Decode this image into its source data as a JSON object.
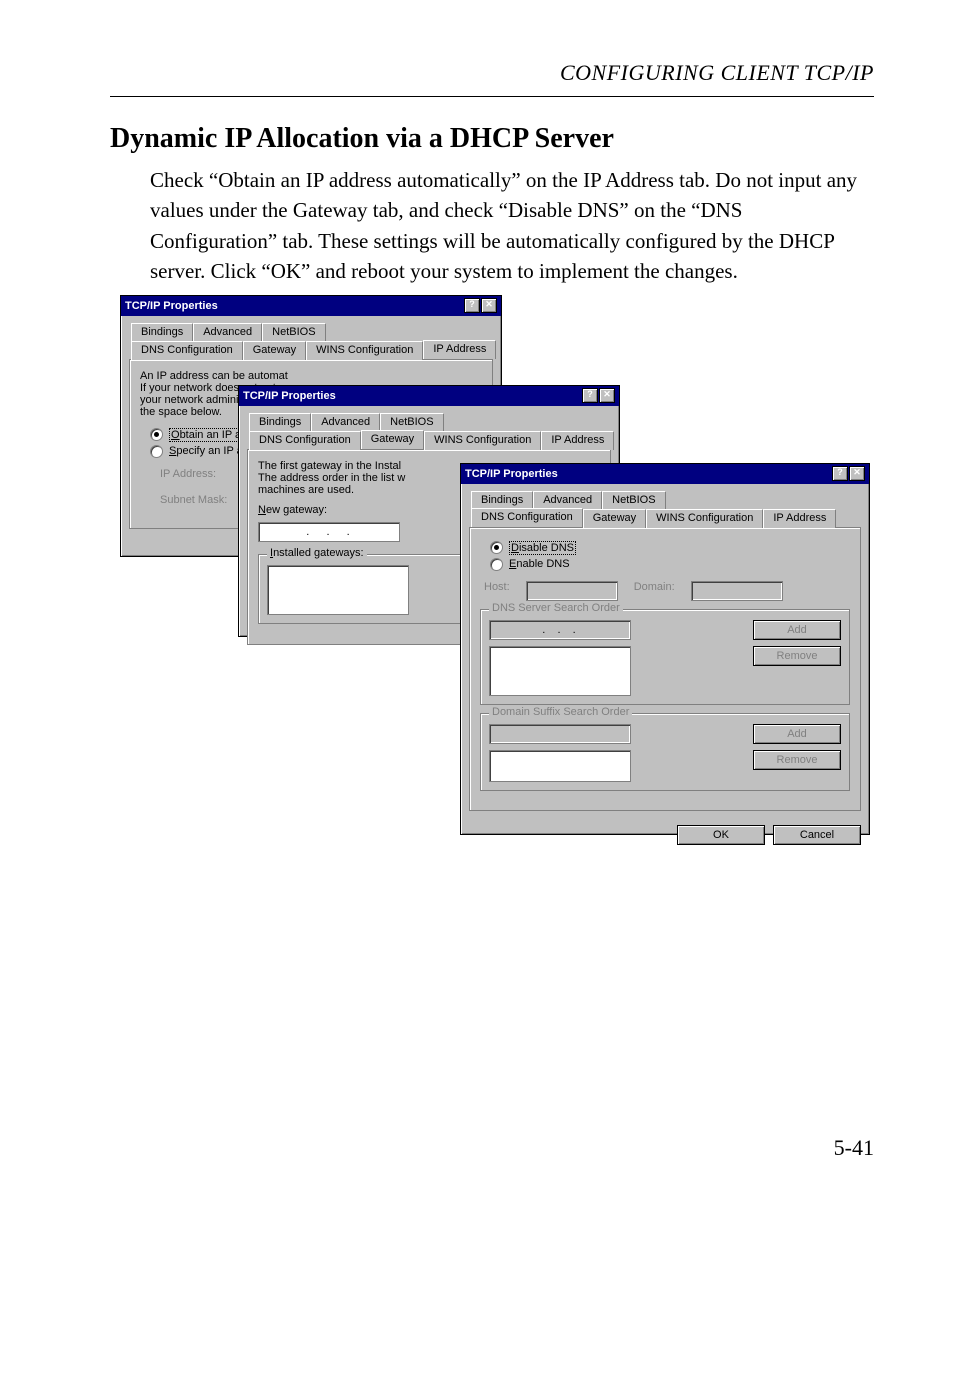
{
  "header": "CONFIGURING CLIENT TCP/IP",
  "section_title": "Dynamic IP Allocation via a DHCP Server",
  "body_text": "Check “Obtain an IP address automatically” on the IP Address tab. Do not input any values under the Gateway tab, and check “Disable DNS” on the “DNS Configuration” tab. These settings will be automatically configured by the DHCP server. Click “OK” and reboot your system to implement the changes.",
  "page_number": "5-41",
  "tbtn": {
    "help": "?",
    "close": "✕"
  },
  "dlg1": {
    "title": "TCP/IP Properties",
    "tabs_back": [
      "Bindings",
      "Advanced",
      "NetBIOS"
    ],
    "tabs_front": [
      "DNS Configuration",
      "Gateway",
      "WINS Configuration",
      "IP Address"
    ],
    "intro": "An IP address can be automat\nIf your network does not auto\nyour network administrator for\nthe space below.",
    "radio_obtain": "Obtain an IP address au",
    "radio_specify": "Specify an IP address:",
    "lbl_ip": "IP Address:",
    "lbl_mask": "Subnet Mask:"
  },
  "dlg2": {
    "title": "TCP/IP Properties",
    "tabs_back": [
      "Bindings",
      "Advanced",
      "NetBIOS"
    ],
    "tabs_front": [
      "DNS Configuration",
      "Gateway",
      "WINS Configuration",
      "IP Address"
    ],
    "intro": "The first gateway in the Instal\nThe address order in the list w\nmachines are used.",
    "lbl_new_gateway": "New gateway:",
    "lbl_installed": "Installed gateways:"
  },
  "dlg3": {
    "title": "TCP/IP Properties",
    "tabs_back": [
      "Bindings",
      "Advanced",
      "NetBIOS"
    ],
    "tabs_front": [
      "DNS Configuration",
      "Gateway",
      "WINS Configuration",
      "IP Address"
    ],
    "radio_disable": "Disable DNS",
    "radio_enable": "Enable DNS",
    "lbl_host": "Host:",
    "lbl_domain": "Domain:",
    "grp_dns": "DNS Server Search Order",
    "grp_suffix": "Domain Suffix Search Order",
    "btn_add": "Add",
    "btn_remove": "Remove",
    "btn_ok": "OK",
    "btn_cancel": "Cancel"
  }
}
